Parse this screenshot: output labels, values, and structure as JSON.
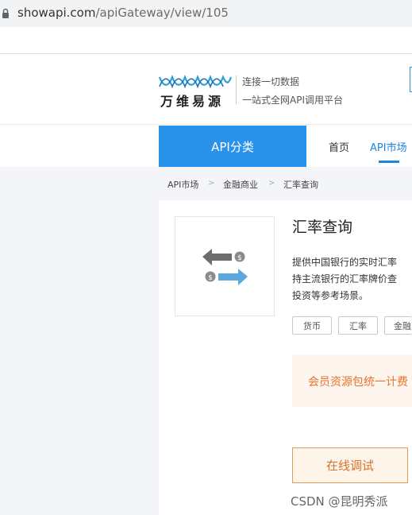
{
  "browser": {
    "url_host": "showapi.com",
    "url_path": "/apiGateway/view/105"
  },
  "header": {
    "brand": "万维易源",
    "slogan_line1": "连接一切数据",
    "slogan_line2": "一站式全网API调用平台"
  },
  "nav": {
    "category_label": "API分类",
    "items": [
      "首页",
      "API市场"
    ],
    "active_item": "API市场",
    "accent_color": "#2a93e9"
  },
  "breadcrumb": [
    "API市场",
    "金融商业",
    "汇率查询"
  ],
  "breadcrumb_separator": ">",
  "api": {
    "title": "汇率查询",
    "icon": "currency-exchange-icon",
    "description_lines": [
      "提供中国银行的实时汇率",
      "持主流银行的汇率牌价查",
      "投资等参考场景。"
    ],
    "tags": [
      "货币",
      "汇率",
      "金融"
    ]
  },
  "member_banner": "会员资源包统一计费",
  "online_test_button": "在线调试",
  "watermark": "CSDN @昆明秀派"
}
